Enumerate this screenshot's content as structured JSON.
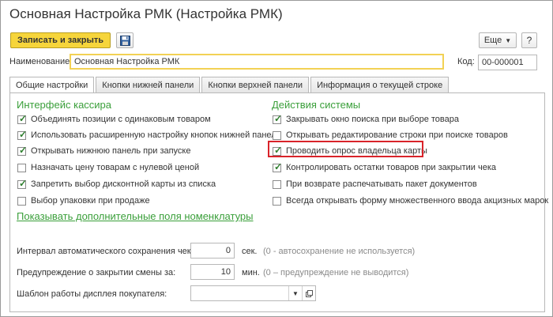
{
  "window": {
    "title": "Основная Настройка РМК (Настройка РМК)"
  },
  "toolbar": {
    "save_close": "Записать и закрыть",
    "more": "Еще",
    "help": "?"
  },
  "fields": {
    "name_label": "Наименование:",
    "name_value": "Основная Настройка РМК",
    "code_label": "Код:",
    "code_value": "00-000001"
  },
  "tabs": [
    {
      "label": "Общие настройки",
      "active": true
    },
    {
      "label": "Кнопки нижней панели",
      "active": false
    },
    {
      "label": "Кнопки верхней панели",
      "active": false
    },
    {
      "label": "Информация о текущей строке",
      "active": false
    }
  ],
  "cashier": {
    "title": "Интерфейс кассира",
    "items": [
      {
        "label": "Объединять позиции с одинаковым товаром",
        "checked": true
      },
      {
        "label": "Использовать расширенную настройку кнопок нижней панели",
        "checked": true
      },
      {
        "label": "Открывать нижнюю панель при запуске",
        "checked": true
      },
      {
        "label": "Назначать цену товарам с нулевой ценой",
        "checked": false
      },
      {
        "label": "Запретить выбор дисконтной карты из списка",
        "checked": true
      },
      {
        "label": "Выбор упаковки при продаже",
        "checked": false
      }
    ],
    "link": "Показывать дополнительные поля номенклатуры"
  },
  "system": {
    "title": "Действия системы",
    "items": [
      {
        "label": "Закрывать окно поиска при выборе товара",
        "checked": true
      },
      {
        "label": "Открывать редактирование строки при поиске товаров",
        "checked": false
      },
      {
        "label": "Проводить опрос владельца карты",
        "checked": true
      },
      {
        "label": "Контролировать остатки товаров при закрытии чека",
        "checked": true
      },
      {
        "label": "При возврате распечатывать пакет документов",
        "checked": false
      },
      {
        "label": "Всегда открывать форму множественного ввода акцизных марок",
        "checked": false
      }
    ]
  },
  "settings": {
    "autosave_label": "Интервал автоматического сохранения чека:",
    "autosave_value": "0",
    "autosave_unit": "сек.",
    "autosave_hint": "(0 - автосохранение не используется)",
    "warn_label": "Предупреждение о закрытии смены за:",
    "warn_value": "10",
    "warn_unit": "мин.",
    "warn_hint": "(0 – предупреждение не выводится)",
    "display_label": "Шаблон работы дисплея покупателя:",
    "display_value": ""
  },
  "colors": {
    "accent_green": "#3a9f3a",
    "primary_button": "#f6d53b",
    "highlight": "#d9232a"
  }
}
